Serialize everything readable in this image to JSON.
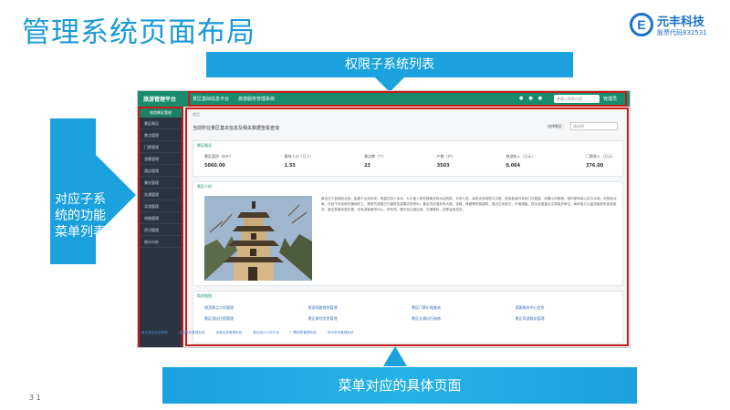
{
  "slide": {
    "title": "管理系统页面布局",
    "bottom_left_mark": "3 1"
  },
  "logo": {
    "mark": "E",
    "name": "元丰科技",
    "code": "股票代码832531"
  },
  "callouts": {
    "top": "权限子系统列表",
    "left": "对应子系统的功能菜单列表",
    "bottom": "菜单对应的具体页面"
  },
  "app": {
    "brand": "旅游管理平台",
    "nav": [
      "景区基础信息平台",
      "旅游服务管理系统"
    ],
    "search_placeholder": "请输入搜索内容",
    "user": "管理员",
    "sidebar_header": "旅游景区管理",
    "menu": [
      "景区概况",
      "景点管理",
      "门票管理",
      "游客管理",
      "酒店管理",
      "餐饮管理",
      "交通管理",
      "导游管理",
      "线路管理",
      "资讯管理",
      "统计分析"
    ],
    "breadcrumb": "首页",
    "page_heading": "当前所在景区基本信息及相关数据查看查询",
    "filter_label": "选择景区：",
    "filter_value": "请选择",
    "stats_title": "景区概况",
    "stats": [
      {
        "label": "景区面积（km²）",
        "value": "5060.00"
      },
      {
        "label": "接待人口（万人）",
        "value": "1.53"
      },
      {
        "label": "景点数（个）",
        "value": "23"
      },
      {
        "label": "户数（户）",
        "value": "3503"
      },
      {
        "label": "旅游收入（万元）",
        "value": "0.064"
      },
      {
        "label": "门票收入（万元）",
        "value": "376.00"
      }
    ],
    "intro_title": "景区介绍",
    "intro_text": "景区位于县城西北部，始建于北宋年间，塔高约四十余米，为平面八角形楼阁式砖木结构塔，共有七层，每层设有塔檐与平座，塔身各面开有拱门与假窗，砖雕斗拱精美。塔内原有塔心柱与木梯，可登临远眺，历经千年风雨仍巍然屹立，是研究我国古代建筑的重要实物资料。景区内还保存有大殿、钟楼、碑廊等附属建筑，周边古树参天，环境清幽，现为全国重点文物保护单位，每年吸引大量游客前来参观游览，景区配套设施完善，设有游客服务中心、停车场、餐饮及住宿区域，交通便利，四季皆宜游览。",
    "links_title": "相关链接",
    "links": [
      "旅游景点介绍管理",
      "旅游线路规划管理",
      "景区门票价格查询",
      "游客服务中心信息",
      "景区酒店住宿管理",
      "景区餐饮信息管理",
      "景区交通出行指南",
      "景区导游服务管理"
    ],
    "footer_links": [
      "景区基础信息管理",
      "旅游服务管理系统",
      "游客信息管理系统",
      "景区统计分析平台",
      "门票销售管理系统",
      "资讯发布管理系统"
    ]
  }
}
